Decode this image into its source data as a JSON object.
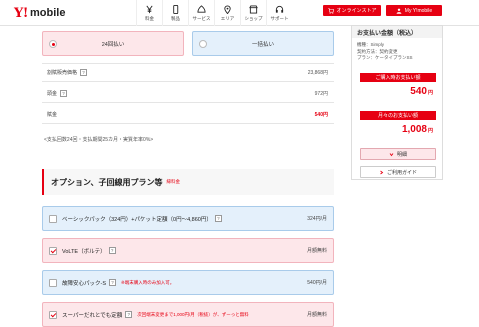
{
  "header": {
    "logo_y": "Y!",
    "logo_text": "mobile",
    "nav": [
      {
        "icon": "yen-icon",
        "label": "料金"
      },
      {
        "icon": "phone-icon",
        "label": "製品"
      },
      {
        "icon": "service-icon",
        "label": "サービス"
      },
      {
        "icon": "map-pin-icon",
        "label": "エリア"
      },
      {
        "icon": "shop-icon",
        "label": "ショップ"
      },
      {
        "icon": "headset-icon",
        "label": "サポート"
      }
    ],
    "online_store": "オンラインストア",
    "my_ymobile": "My Y!mobile"
  },
  "payment": {
    "installment_label": "24回払い",
    "lump_sum_label": "一括払い",
    "selected": "installment"
  },
  "price_table": [
    {
      "label": "割賦販売価格",
      "value": "23,868円",
      "help": "?"
    },
    {
      "label": "頭金",
      "value": "972円",
      "help": "?"
    },
    {
      "label": "賦金",
      "value": "540円",
      "help": ""
    }
  ],
  "installment_note": "<支払回数24回・支払期間25カ月・実質年率0%>",
  "options": {
    "title": "オプション、子回線用プラン等",
    "badge": "縁料金",
    "items": [
      {
        "name": "ベーシックパック（324円）+パケット定額（0円～4,860円）",
        "note": "",
        "price": "324円/月",
        "checked": false,
        "style": "blue"
      },
      {
        "name": "VoLTE（ボルテ）",
        "note": "",
        "price": "月額無料",
        "checked": true,
        "style": "pink"
      },
      {
        "name": "故障安心パック-S",
        "note": "※端末購入時のみ加入可。",
        "price": "540円/月",
        "checked": false,
        "style": "blue"
      },
      {
        "name": "スーパーだれとでも定額",
        "note": "次回端末変更まで1,000円/月（税抜）が、ずーっと無料",
        "price": "月額無料",
        "checked": true,
        "style": "pink"
      }
    ]
  },
  "sidebar": {
    "title": "お支払い金額（税込）",
    "info": [
      "機種：Simply",
      "契約方法：契約変更",
      "プラン：ケータイプランSS"
    ],
    "purchase_label": "ご購入時お支払い額",
    "purchase_amount": "540",
    "monthly_label": "月々のお支払い額",
    "monthly_amount": "1,008",
    "yen": "円",
    "details_button": "明細",
    "guide_button": "ご利用ガイド"
  },
  "colors": {
    "brand_red": "#e60012",
    "option_blue": "#e4f0fb",
    "option_pink": "#fde7ea"
  }
}
